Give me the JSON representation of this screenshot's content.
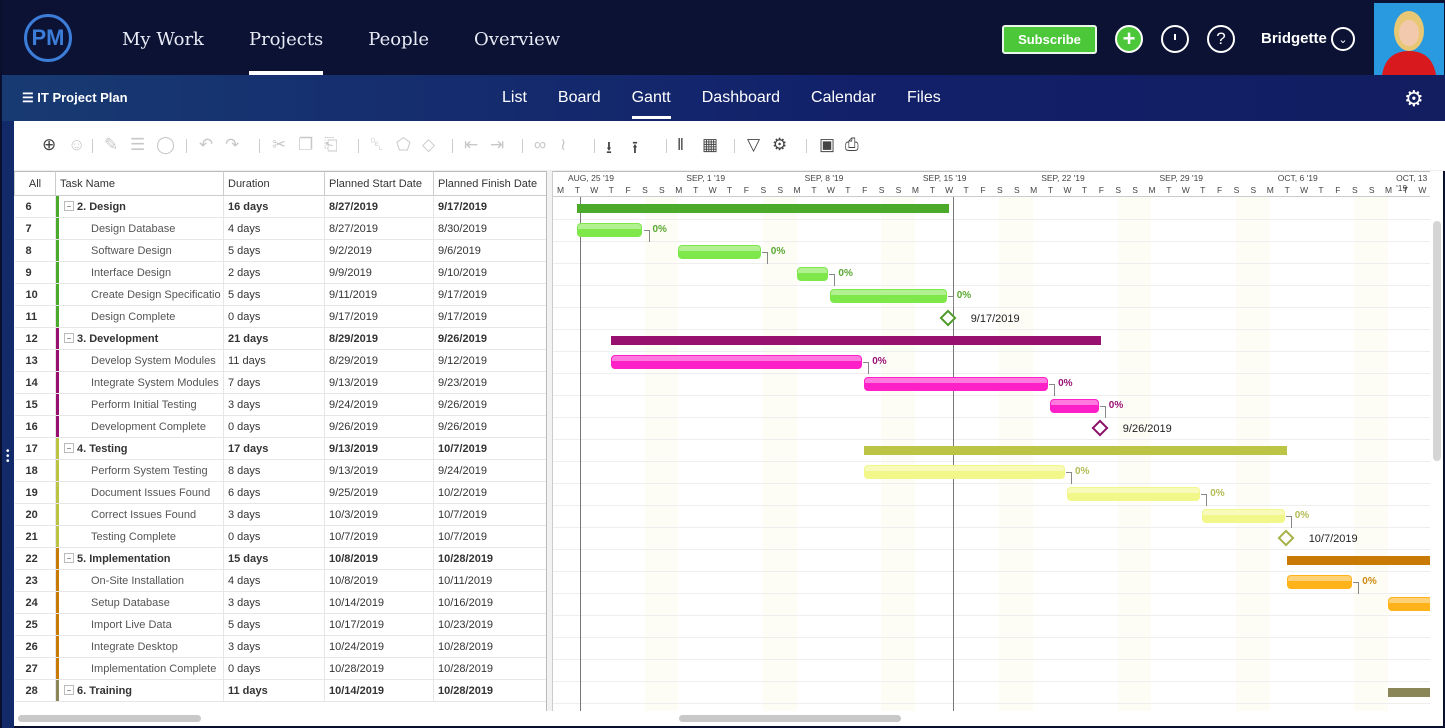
{
  "app": {
    "logo_text": "PM"
  },
  "topnav": {
    "items": [
      {
        "label": "My Work",
        "active": false
      },
      {
        "label": "Projects",
        "active": true
      },
      {
        "label": "People",
        "active": false
      },
      {
        "label": "Overview",
        "active": false
      }
    ],
    "subscribe_label": "Subscribe",
    "user_name": "Bridgette"
  },
  "project": {
    "title": "IT Project Plan",
    "tabs": [
      {
        "label": "List",
        "active": false
      },
      {
        "label": "Board",
        "active": false
      },
      {
        "label": "Gantt",
        "active": true
      },
      {
        "label": "Dashboard",
        "active": false
      },
      {
        "label": "Calendar",
        "active": false
      },
      {
        "label": "Files",
        "active": false
      }
    ]
  },
  "toolbar": {
    "icons": [
      "add-task-icon",
      "assign-user-icon",
      "edit-icon",
      "notes-icon",
      "comment-icon",
      "undo-icon",
      "redo-icon",
      "cut-icon",
      "copy-icon",
      "paste-icon",
      "delete-icon",
      "tag-icon",
      "milestone-icon",
      "outdent-icon",
      "indent-icon",
      "link-icon",
      "unlink-icon",
      "import-icon",
      "export-icon",
      "columns-icon",
      "grid-icon",
      "filter-icon",
      "settings-icon",
      "save-icon",
      "print-icon"
    ]
  },
  "grid": {
    "columns": [
      "All",
      "Task Name",
      "Duration",
      "Planned Start Date",
      "Planned Finish Date"
    ],
    "rows": [
      {
        "id": "6",
        "name": "2. Design",
        "duration": "16 days",
        "start": "8/27/2019",
        "finish": "9/17/2019",
        "summary": true,
        "group": "design"
      },
      {
        "id": "7",
        "name": "Design Database",
        "duration": "4 days",
        "start": "8/27/2019",
        "finish": "8/30/2019",
        "summary": false,
        "group": "design"
      },
      {
        "id": "8",
        "name": "Software Design",
        "duration": "5 days",
        "start": "9/2/2019",
        "finish": "9/6/2019",
        "summary": false,
        "group": "design"
      },
      {
        "id": "9",
        "name": "Interface Design",
        "duration": "2 days",
        "start": "9/9/2019",
        "finish": "9/10/2019",
        "summary": false,
        "group": "design"
      },
      {
        "id": "10",
        "name": "Create Design Specificatio",
        "duration": "5 days",
        "start": "9/11/2019",
        "finish": "9/17/2019",
        "summary": false,
        "group": "design"
      },
      {
        "id": "11",
        "name": "Design Complete",
        "duration": "0 days",
        "start": "9/17/2019",
        "finish": "9/17/2019",
        "summary": false,
        "group": "design"
      },
      {
        "id": "12",
        "name": "3. Development",
        "duration": "21 days",
        "start": "8/29/2019",
        "finish": "9/26/2019",
        "summary": true,
        "group": "development"
      },
      {
        "id": "13",
        "name": "Develop System Modules",
        "duration": "11 days",
        "start": "8/29/2019",
        "finish": "9/12/2019",
        "summary": false,
        "group": "development"
      },
      {
        "id": "14",
        "name": "Integrate System Modules",
        "duration": "7 days",
        "start": "9/13/2019",
        "finish": "9/23/2019",
        "summary": false,
        "group": "development"
      },
      {
        "id": "15",
        "name": "Perform Initial Testing",
        "duration": "3 days",
        "start": "9/24/2019",
        "finish": "9/26/2019",
        "summary": false,
        "group": "development"
      },
      {
        "id": "16",
        "name": "Development Complete",
        "duration": "0 days",
        "start": "9/26/2019",
        "finish": "9/26/2019",
        "summary": false,
        "group": "development"
      },
      {
        "id": "17",
        "name": "4. Testing",
        "duration": "17 days",
        "start": "9/13/2019",
        "finish": "10/7/2019",
        "summary": true,
        "group": "testing"
      },
      {
        "id": "18",
        "name": "Perform System Testing",
        "duration": "8 days",
        "start": "9/13/2019",
        "finish": "9/24/2019",
        "summary": false,
        "group": "testing"
      },
      {
        "id": "19",
        "name": "Document Issues Found",
        "duration": "6 days",
        "start": "9/25/2019",
        "finish": "10/2/2019",
        "summary": false,
        "group": "testing"
      },
      {
        "id": "20",
        "name": "Correct Issues Found",
        "duration": "3 days",
        "start": "10/3/2019",
        "finish": "10/7/2019",
        "summary": false,
        "group": "testing"
      },
      {
        "id": "21",
        "name": "Testing Complete",
        "duration": "0 days",
        "start": "10/7/2019",
        "finish": "10/7/2019",
        "summary": false,
        "group": "testing"
      },
      {
        "id": "22",
        "name": "5. Implementation",
        "duration": "15 days",
        "start": "10/8/2019",
        "finish": "10/28/2019",
        "summary": true,
        "group": "implementation"
      },
      {
        "id": "23",
        "name": "On-Site Installation",
        "duration": "4 days",
        "start": "10/8/2019",
        "finish": "10/11/2019",
        "summary": false,
        "group": "implementation"
      },
      {
        "id": "24",
        "name": "Setup Database",
        "duration": "3 days",
        "start": "10/14/2019",
        "finish": "10/16/2019",
        "summary": false,
        "group": "implementation"
      },
      {
        "id": "25",
        "name": "Import Live Data",
        "duration": "5 days",
        "start": "10/17/2019",
        "finish": "10/23/2019",
        "summary": false,
        "group": "implementation"
      },
      {
        "id": "26",
        "name": "Integrate Desktop",
        "duration": "3 days",
        "start": "10/24/2019",
        "finish": "10/28/2019",
        "summary": false,
        "group": "implementation"
      },
      {
        "id": "27",
        "name": "Implementation Complete",
        "duration": "0 days",
        "start": "10/28/2019",
        "finish": "10/28/2019",
        "summary": false,
        "group": "implementation"
      },
      {
        "id": "28",
        "name": "6. Training",
        "duration": "11 days",
        "start": "10/14/2019",
        "finish": "10/28/2019",
        "summary": true,
        "group": "training"
      }
    ]
  },
  "colors": {
    "design": {
      "summary": "#4caa2a",
      "bar": "#7ee84a",
      "text": "#5aa830",
      "milestone": "#4e9a2a"
    },
    "development": {
      "summary": "#98106f",
      "bar": "#ff20c8",
      "text": "#9a1074",
      "milestone": "#8a1268"
    },
    "testing": {
      "summary": "#bcc446",
      "bar": "#f2f78a",
      "text": "#b3bc55",
      "milestone": "#a8b24a"
    },
    "implementation": {
      "summary": "#c97a05",
      "bar": "#ffb21a",
      "text": "#d08a10",
      "milestone": "#c97a05"
    },
    "training": {
      "summary": "#8a8658",
      "bar": "#c8c48a",
      "text": "#8a8658",
      "milestone": "#8a8658"
    }
  },
  "timeline": {
    "weeks": [
      "AUG, 25 '19",
      "SEP, 1 '19",
      "SEP, 8 '19",
      "SEP, 15 '19",
      "SEP, 22 '19",
      "SEP, 29 '19",
      "OCT, 6 '19",
      "OCT, 13 '19"
    ],
    "day_letters": [
      "S",
      "M",
      "T",
      "W",
      "T",
      "F",
      "S"
    ],
    "milestone_labels": {
      "11": "9/17/2019",
      "16": "9/26/2019",
      "21": "10/7/2019"
    },
    "progress_label": "0%"
  }
}
